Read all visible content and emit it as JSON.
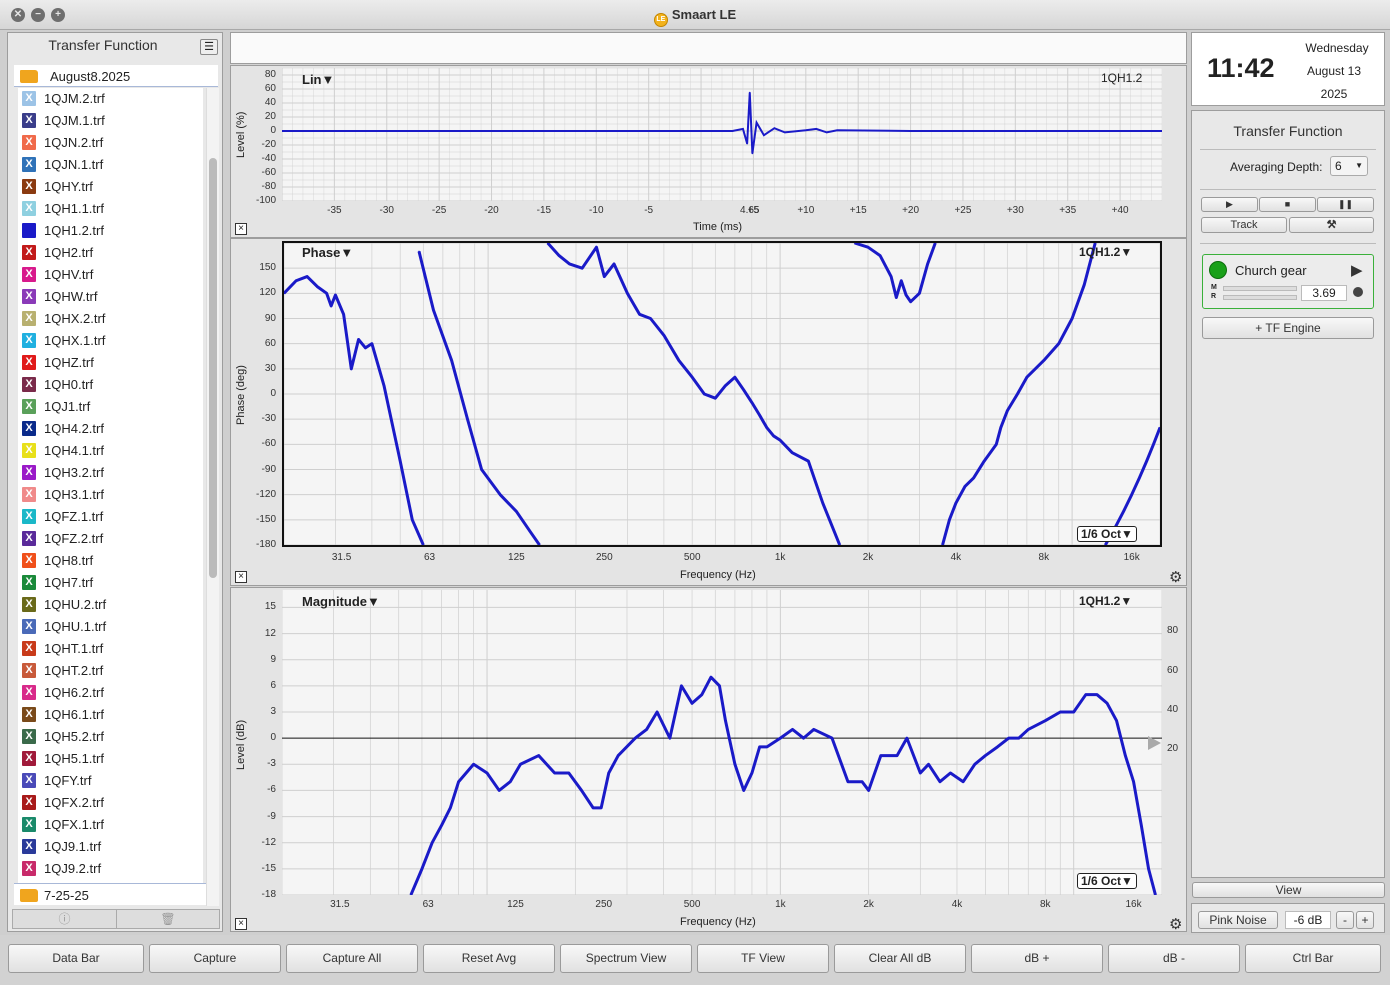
{
  "window": {
    "title": "Smaart LE",
    "logo_text": "LE"
  },
  "colors": {
    "trace": "#1a1ac8",
    "accent_green": "#19a019",
    "folder": "#f0a51e",
    "grid": "#cfcfcf"
  },
  "left_panel": {
    "title": "Transfer Function",
    "folder": "August8.2025",
    "files": [
      {
        "name": "1QJM.2.trf",
        "color": "#9cc3e6"
      },
      {
        "name": "1QJM.1.trf",
        "color": "#3a3d8a"
      },
      {
        "name": "1QJN.2.trf",
        "color": "#f06a4a"
      },
      {
        "name": "1QJN.1.trf",
        "color": "#2f72b8"
      },
      {
        "name": "1QHY.trf",
        "color": "#8a3a10"
      },
      {
        "name": "1QH1.1.trf",
        "color": "#8fd0e0"
      },
      {
        "name": "1QH1.2.trf",
        "color": "#1a1ac8",
        "solid": true
      },
      {
        "name": "1QH2.trf",
        "color": "#c21a1a"
      },
      {
        "name": "1QHV.trf",
        "color": "#d81a8c"
      },
      {
        "name": "1QHW.trf",
        "color": "#8a3ab8"
      },
      {
        "name": "1QHX.2.trf",
        "color": "#b8b070"
      },
      {
        "name": "1QHX.1.trf",
        "color": "#20b0e0"
      },
      {
        "name": "1QHZ.trf",
        "color": "#e01a1a"
      },
      {
        "name": "1QH0.trf",
        "color": "#7a2a4a"
      },
      {
        "name": "1QJ1.trf",
        "color": "#5aa05a"
      },
      {
        "name": "1QH4.2.trf",
        "color": "#0a2a8a"
      },
      {
        "name": "1QH4.1.trf",
        "color": "#e8e01a"
      },
      {
        "name": "1QH3.2.trf",
        "color": "#9a1ac8"
      },
      {
        "name": "1QH3.1.trf",
        "color": "#f08a8a"
      },
      {
        "name": "1QFZ.1.trf",
        "color": "#1ab8c8"
      },
      {
        "name": "1QFZ.2.trf",
        "color": "#5a2a9a"
      },
      {
        "name": "1QH8.trf",
        "color": "#f0501a"
      },
      {
        "name": "1QH7.trf",
        "color": "#1a8a3a"
      },
      {
        "name": "1QHU.2.trf",
        "color": "#6a6a1a"
      },
      {
        "name": "1QHU.1.trf",
        "color": "#4a6ab8"
      },
      {
        "name": "1QHT.1.trf",
        "color": "#c83a1a"
      },
      {
        "name": "1QHT.2.trf",
        "color": "#c85a3a"
      },
      {
        "name": "1QH6.2.trf",
        "color": "#d82a8a"
      },
      {
        "name": "1QH6.1.trf",
        "color": "#7a4a1a"
      },
      {
        "name": "1QH5.2.trf",
        "color": "#3a6a4a"
      },
      {
        "name": "1QH5.1.trf",
        "color": "#a01a3a"
      },
      {
        "name": "1QFY.trf",
        "color": "#4a4ab8"
      },
      {
        "name": "1QFX.2.trf",
        "color": "#a81a1a"
      },
      {
        "name": "1QFX.1.trf",
        "color": "#1a8a6a"
      },
      {
        "name": "1QJ9.1.trf",
        "color": "#2a3a9a"
      },
      {
        "name": "1QJ9.2.trf",
        "color": "#c82a6a"
      }
    ],
    "folder2": "7-25-25",
    "footer_icons": [
      "info-icon",
      "trash-icon"
    ]
  },
  "impulse_plot": {
    "name": "Lin",
    "tag": "1QH1.2",
    "ylabel": "Level (%)",
    "xlabel": "Time (ms)",
    "yticks": [
      "80",
      "60",
      "40",
      "20",
      "0",
      "-20",
      "-40",
      "-60",
      "-80",
      "-100"
    ],
    "xticks": [
      "-35",
      "-30",
      "-25",
      "-20",
      "-15",
      "-10",
      "-5",
      "4.65",
      "+5",
      "+10",
      "+15",
      "+20",
      "+25",
      "+30",
      "+35",
      "+40"
    ]
  },
  "phase_plot": {
    "name": "Phase",
    "tag": "1QH1.2",
    "ylabel": "Phase (deg)",
    "xlabel": "Frequency (Hz)",
    "smoothing": "1/6 Oct",
    "yticks": [
      "150",
      "120",
      "90",
      "60",
      "30",
      "0",
      "-30",
      "-60",
      "-90",
      "-120",
      "-150",
      "-180"
    ],
    "xticks": [
      "31.5",
      "63",
      "125",
      "250",
      "500",
      "1k",
      "2k",
      "4k",
      "8k",
      "16k"
    ]
  },
  "magnitude_plot": {
    "name": "Magnitude",
    "tag": "1QH1.2",
    "ylabel": "Level (dB)",
    "xlabel": "Frequency (Hz)",
    "smoothing": "1/6 Oct",
    "yticks": [
      "15",
      "12",
      "9",
      "6",
      "3",
      "0",
      "-3",
      "-6",
      "-9",
      "-12",
      "-15",
      "-18"
    ],
    "yticks_right": [
      "80",
      "60",
      "40",
      "20"
    ],
    "xticks": [
      "31.5",
      "63",
      "125",
      "250",
      "500",
      "1k",
      "2k",
      "4k",
      "8k",
      "16k"
    ]
  },
  "chart_data": [
    {
      "type": "line",
      "title": "Lin",
      "xlabel": "Time (ms)",
      "ylabel": "Level (%)",
      "xlim": [
        -40,
        44
      ],
      "ylim": [
        -100,
        90
      ],
      "grid": true,
      "series": [
        {
          "name": "1QH1.2",
          "x": [
            -40,
            3,
            4.0,
            4.4,
            4.65,
            4.9,
            5.3,
            6,
            7,
            8,
            10,
            11,
            12,
            13,
            20,
            44
          ],
          "y": [
            0,
            0,
            3,
            -18,
            55,
            -32,
            12,
            -6,
            4,
            -2,
            1,
            3,
            -2,
            1,
            0,
            0
          ]
        }
      ]
    },
    {
      "type": "line",
      "title": "Phase",
      "xlabel": "Frequency (Hz)",
      "ylabel": "Phase (deg)",
      "xscale": "log",
      "xlim": [
        20,
        20000
      ],
      "ylim": [
        -180,
        180
      ],
      "grid": true,
      "series": [
        {
          "name": "1QH1.2",
          "x": [
            20,
            22,
            24,
            26,
            28,
            29,
            30,
            32,
            34,
            36,
            38,
            40,
            44,
            50,
            55,
            60,
            58,
            65,
            75,
            85,
            95,
            110,
            125,
            140,
            150,
            160,
            175,
            190,
            210,
            235,
            250,
            270,
            300,
            330,
            360,
            400,
            450,
            500,
            550,
            600,
            650,
            700,
            750,
            800,
            850,
            900,
            950,
            1000,
            1100,
            1250,
            1400,
            1600,
            1800,
            2000,
            2200,
            2400,
            2500,
            2600,
            2700,
            2800,
            3000,
            3200,
            3400,
            3600,
            3800,
            4000,
            4300,
            4600,
            5000,
            5500,
            5700,
            6000,
            6500,
            7000,
            8000,
            9000,
            10000,
            11000,
            12000,
            13000,
            14000,
            15000,
            16000,
            17000,
            18000,
            19000,
            20000
          ],
          "y": [
            120,
            135,
            140,
            128,
            120,
            105,
            118,
            95,
            30,
            65,
            55,
            60,
            10,
            -80,
            -150,
            -180,
            170,
            100,
            40,
            -30,
            -90,
            -120,
            -140,
            -165,
            -180,
            180,
            165,
            155,
            150,
            175,
            140,
            155,
            120,
            95,
            90,
            70,
            40,
            20,
            0,
            -5,
            10,
            20,
            5,
            -10,
            -25,
            -40,
            -50,
            -55,
            -70,
            -80,
            -130,
            -180,
            180,
            175,
            165,
            140,
            115,
            135,
            118,
            110,
            120,
            155,
            180,
            -180,
            -150,
            -130,
            -110,
            -100,
            -80,
            -60,
            -40,
            -20,
            0,
            20,
            40,
            60,
            90,
            130,
            180,
            -180,
            -160,
            -140,
            -120,
            -100,
            -80,
            -60,
            -40
          ]
        }
      ]
    },
    {
      "type": "line",
      "title": "Magnitude",
      "xlabel": "Frequency (Hz)",
      "ylabel": "Level (dB)",
      "xscale": "log",
      "xlim": [
        20,
        20000
      ],
      "ylim": [
        -18,
        17
      ],
      "grid": true,
      "series": [
        {
          "name": "1QH1.2",
          "x": [
            55,
            60,
            65,
            70,
            75,
            80,
            90,
            100,
            110,
            120,
            130,
            150,
            170,
            190,
            210,
            230,
            245,
            260,
            280,
            320,
            350,
            380,
            420,
            460,
            500,
            540,
            580,
            620,
            650,
            700,
            750,
            800,
            850,
            900,
            1000,
            1100,
            1200,
            1300,
            1500,
            1700,
            1900,
            2000,
            2200,
            2500,
            2700,
            3000,
            3200,
            3500,
            3800,
            4200,
            4600,
            5000,
            5500,
            6000,
            6500,
            7000,
            8000,
            9000,
            10000,
            11000,
            12000,
            13000,
            14000,
            15000,
            16000,
            17000,
            18000,
            19000
          ],
          "y": [
            -18,
            -15,
            -12,
            -10,
            -8,
            -5,
            -3,
            -4,
            -6,
            -5,
            -3,
            -2,
            -4,
            -4,
            -6,
            -8,
            -8,
            -4,
            -2,
            0,
            1,
            3,
            0,
            6,
            4,
            5,
            7,
            6,
            2,
            -3,
            -6,
            -4,
            -1,
            -1,
            0,
            1,
            0,
            1,
            0,
            -5,
            -5,
            -6,
            -2,
            -2,
            0,
            -4,
            -3,
            -5,
            -4,
            -5,
            -3,
            -2,
            -1,
            0,
            0,
            1,
            2,
            3,
            3,
            5,
            5,
            4,
            2,
            -2,
            -5,
            -10,
            -15,
            -18
          ]
        }
      ]
    }
  ],
  "clock": {
    "time": "11:42",
    "weekday": "Wednesday",
    "date": "August 13",
    "year": "2025"
  },
  "right_panel": {
    "title": "Transfer Function",
    "averaging_label": "Averaging Depth:",
    "averaging_value": "6",
    "track_label": "Track",
    "engine_name": "Church gear",
    "meter_m": "M",
    "meter_r": "R",
    "engine_value": "3.69",
    "add_engine_label": "+ TF Engine",
    "view_label": "View",
    "pink_noise_label": "Pink Noise",
    "pink_noise_level": "-6 dB",
    "minus_label": "-",
    "plus_label": "+"
  },
  "bottom_bar": {
    "buttons": [
      "Data Bar",
      "Capture",
      "Capture All",
      "Reset Avg",
      "Spectrum View",
      "TF View",
      "Clear All dB",
      "dB +",
      "dB -",
      "Ctrl Bar"
    ]
  }
}
